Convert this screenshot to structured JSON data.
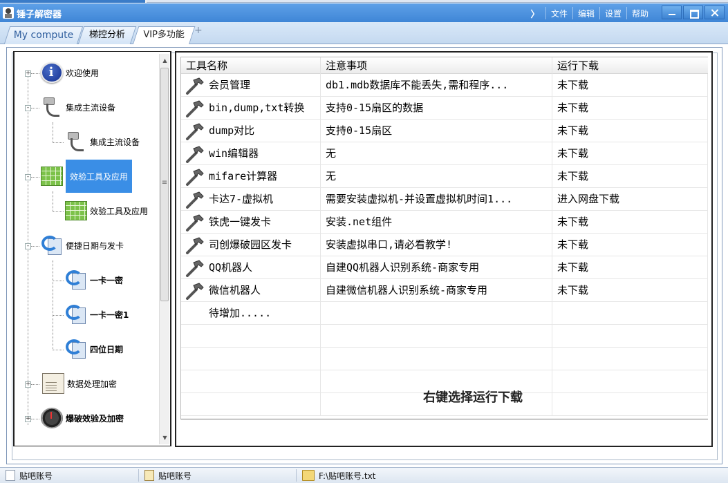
{
  "window": {
    "title": "锤子解密器",
    "menu": [
      "文件",
      "编辑",
      "设置",
      "帮助"
    ],
    "chevron": "〉"
  },
  "tabs": [
    {
      "label": "My compute"
    },
    {
      "label": "梯控分析"
    },
    {
      "label": "VIP多功能"
    }
  ],
  "tab_add": "+",
  "tree": [
    {
      "label": "欢迎使用",
      "icon": "info-icon",
      "expander": "+"
    },
    {
      "label": "集成主流设备",
      "icon": "usb-device-icon",
      "expander": "-"
    },
    {
      "label": "集成主流设备",
      "icon": "usb-device-icon"
    },
    {
      "label": "效验工具及应用",
      "icon": "spreadsheet-icon",
      "expander": "-",
      "selected": true
    },
    {
      "label": "效验工具及应用",
      "icon": "spreadsheet-icon"
    },
    {
      "label": "便捷日期与发卡",
      "icon": "date-sync-icon",
      "expander": "-"
    },
    {
      "label": "一卡一密",
      "icon": "date-sync-icon",
      "bold": true
    },
    {
      "label": "一卡一密1",
      "icon": "date-sync-icon",
      "bold": true
    },
    {
      "label": "四位日期",
      "icon": "date-sync-icon",
      "bold": true
    },
    {
      "label": "数据处理加密",
      "icon": "document-icon",
      "expander": "+"
    },
    {
      "label": "爆破效验及加密",
      "icon": "clock-icon",
      "expander": "+",
      "bold": true
    }
  ],
  "list": {
    "headers": [
      "工具名称",
      "注意事项",
      "运行下载"
    ],
    "rows": [
      {
        "name": "会员管理",
        "note": "db1.mdb数据库不能丢失,需和程序...",
        "status": "未下载"
      },
      {
        "name": "bin,dump,txt转换",
        "note": "支持0-15扇区的数据",
        "status": "未下载"
      },
      {
        "name": "dump对比",
        "note": "支持0-15扇区",
        "status": "未下载"
      },
      {
        "name": "win编辑器",
        "note": "无",
        "status": "未下载"
      },
      {
        "name": "mifare计算器",
        "note": "无",
        "status": "未下载"
      },
      {
        "name": "卡达7-虚拟机",
        "note": "需要安装虚拟机-并设置虚拟机时间1...",
        "status": "进入网盘下载"
      },
      {
        "name": "铁虎一键发卡",
        "note": "安装.net组件",
        "status": "未下载"
      },
      {
        "name": "司创爆破园区发卡",
        "note": "安装虚拟串口,请必看教学!",
        "status": "未下载"
      },
      {
        "name": "QQ机器人",
        "note": "自建QQ机器人识别系统-商家专用",
        "status": "未下载"
      },
      {
        "name": "微信机器人",
        "note": "自建微信机器人识别系统-商家专用",
        "status": "未下载"
      },
      {
        "name": "待增加.....",
        "note": "",
        "status": ""
      }
    ],
    "hint": "右键选择运行下载"
  },
  "status": [
    "贴吧账号",
    "贴吧账号",
    "F:\\贴吧账号.txt"
  ],
  "colors": {
    "titlebar": "#3f86d6",
    "selection": "#3a8ee6",
    "tabbar": "#c4d9f0"
  }
}
